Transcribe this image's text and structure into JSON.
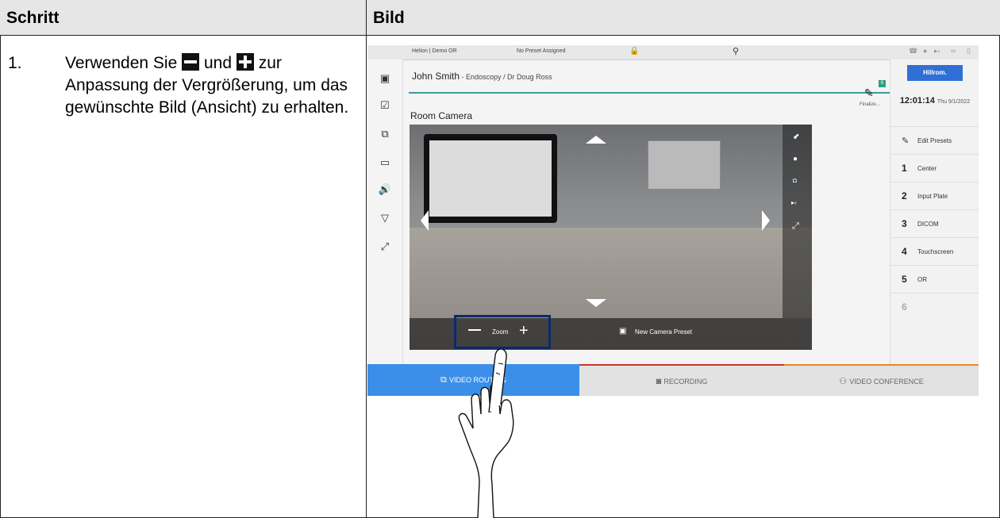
{
  "table": {
    "header_step": "Schritt",
    "header_image": "Bild",
    "step_number": "1.",
    "step_part1": "Verwenden Sie",
    "step_part2": "und",
    "step_part3": "zur Anpassung der Vergrößerung, um das gewünschte Bild (Ansicht) zu erhalten."
  },
  "screenshot": {
    "status_location": "Helion | Demo OR",
    "status_preset": "No Preset Assigned",
    "patient_name": "John Smith",
    "patient_detail": " - Endoscopy / Dr Doug Ross",
    "finalize_label": "Finalize...",
    "finalize_badge": "6",
    "brand": "Hillrom.",
    "time": "12:01:14",
    "date": "Thu 9/1/2022",
    "camera_title": "Room Camera",
    "zoom_label": "Zoom",
    "new_preset_label": "New Camera Preset",
    "edit_presets": "Edit Presets",
    "presets": [
      {
        "num": "1",
        "label": "Center"
      },
      {
        "num": "2",
        "label": "Input Plate"
      },
      {
        "num": "3",
        "label": "DICOM"
      },
      {
        "num": "4",
        "label": "Touchscreen"
      },
      {
        "num": "5",
        "label": "OR"
      },
      {
        "num": "6",
        "label": ""
      }
    ],
    "tabs": [
      "VIDEO ROUTING",
      "RECORDING",
      "VIDEO CONFERENCE"
    ],
    "colors": {
      "accent": "#2f6fd6",
      "teal": "#3a9c9c",
      "zoom_box": "#0b2a6e"
    }
  }
}
